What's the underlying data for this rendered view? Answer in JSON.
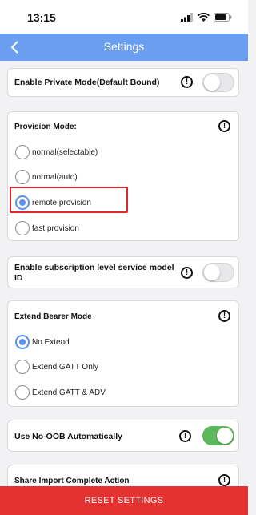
{
  "status_bar": {
    "time": "13:15"
  },
  "nav": {
    "title": "Settings",
    "back_icon": "chevron-left-icon"
  },
  "private_mode": {
    "label": "Enable Private Mode(Default Bound)",
    "enabled": false
  },
  "provision": {
    "label": "Provision Mode:",
    "options": [
      "normal(selectable)",
      "normal(auto)",
      "remote provision",
      "fast provision"
    ],
    "selected": "remote provision"
  },
  "subscription": {
    "label": "Enable subscription level service model ID",
    "enabled": false
  },
  "bearer": {
    "label": "Extend Bearer Mode",
    "options": [
      "No Extend",
      "Extend GATT Only",
      "Extend GATT & ADV"
    ],
    "selected": "No Extend"
  },
  "no_oob": {
    "label": "Use No-OOB Automatically",
    "enabled": true
  },
  "share_import": {
    "label": "Share Import Complete Action"
  },
  "reset_button": {
    "label": "RESET SETTINGS"
  },
  "colors": {
    "nav": "#6a9ef1",
    "accent": "#5b8ff0",
    "toggle_on": "#5cb85c",
    "reset": "#e3322f",
    "highlight": "#e0262b"
  }
}
